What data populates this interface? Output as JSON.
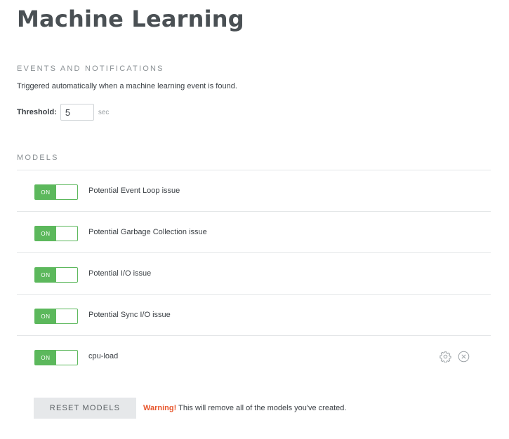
{
  "page": {
    "title": "Machine Learning"
  },
  "events": {
    "heading": "EVENTS AND NOTIFICATIONS",
    "description": "Triggered automatically when a machine learning event is found.",
    "threshold_label": "Threshold:",
    "threshold_value": "5",
    "threshold_unit": "sec"
  },
  "models": {
    "heading": "MODELS",
    "items": [
      {
        "name": "Potential Event Loop issue",
        "toggle": "ON"
      },
      {
        "name": "Potential Garbage Collection issue",
        "toggle": "ON"
      },
      {
        "name": "Potential I/O issue",
        "toggle": "ON"
      },
      {
        "name": "Potential Sync I/O issue",
        "toggle": "ON"
      },
      {
        "name": "cpu-load",
        "toggle": "ON",
        "icons": [
          "gear-icon",
          "close-circle-icon"
        ]
      }
    ]
  },
  "footer": {
    "reset_label": "RESET MODELS",
    "warning_label": "Warning!",
    "warning_text": " This will remove all of the models you've created."
  },
  "colors": {
    "toggle_on": "#5cb85c",
    "warning": "#e8572e",
    "title": "#4a5054"
  }
}
